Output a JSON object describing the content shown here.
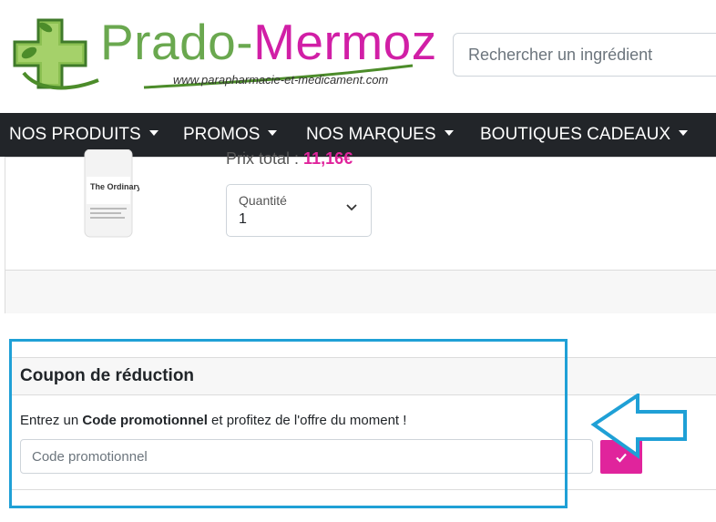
{
  "brand": {
    "name_part1": "Prado-",
    "name_part2": "Mermoz",
    "url": "www.parapharmacie-et-medicament.com",
    "colors": {
      "green": "#6aa84f",
      "pink": "#d11fa6"
    }
  },
  "search": {
    "placeholder": "Rechercher un ingrédient"
  },
  "nav": {
    "items": [
      {
        "label": "NOS PRODUITS"
      },
      {
        "label": "PROMOS"
      },
      {
        "label": "NOS MARQUES"
      },
      {
        "label": "BOUTIQUES CADEAUX"
      }
    ]
  },
  "product": {
    "brand_label": "The Ordinary.",
    "price_label": "Prix total :",
    "price_value": "11,16€",
    "quantity_label": "Quantité",
    "quantity_value": "1"
  },
  "coupon": {
    "title": "Coupon de réduction",
    "text_prefix": "Entrez un ",
    "text_bold": "Code promotionnel",
    "text_suffix": " et profitez de l'offre du moment !",
    "input_placeholder": "Code promotionnel",
    "submit_icon": "check-icon",
    "accent_color": "#e0249c",
    "annotation_color": "#1fa0d6"
  }
}
